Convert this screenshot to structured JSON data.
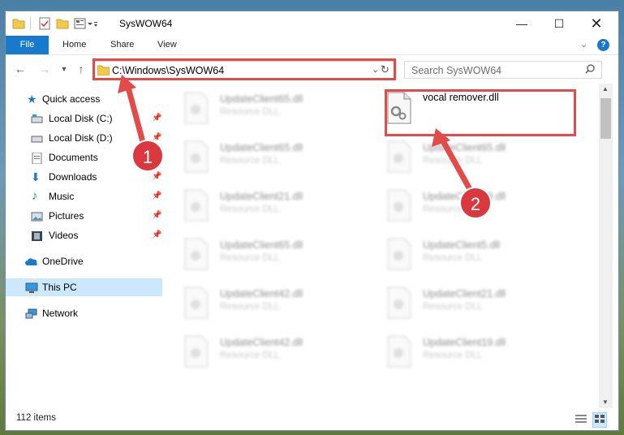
{
  "window": {
    "title": "SysWOW64"
  },
  "ribbon": {
    "tabs": [
      "File",
      "Home",
      "Share",
      "View"
    ]
  },
  "address": {
    "path": "C:\\Windows\\SysWOW64"
  },
  "search": {
    "placeholder": "Search SysWOW64"
  },
  "sidebar": {
    "items": [
      {
        "label": "Quick access"
      },
      {
        "label": "Local Disk (C:)"
      },
      {
        "label": "Local Disk (D:)"
      },
      {
        "label": "Documents"
      },
      {
        "label": "Downloads"
      },
      {
        "label": "Music"
      },
      {
        "label": "Pictures"
      },
      {
        "label": "Videos"
      },
      {
        "label": "OneDrive"
      },
      {
        "label": "This PC"
      },
      {
        "label": "Network"
      }
    ]
  },
  "files": {
    "highlighted": {
      "name": "vocal remover.dll"
    },
    "left": [
      {
        "name": "UpdateClient65.dll",
        "type": "Resource DLL"
      },
      {
        "name": "UpdateClient65.dll",
        "type": "Resource DLL"
      },
      {
        "name": "UpdateClient21.dll",
        "type": "Resource DLL"
      },
      {
        "name": "UpdateClient65.dll",
        "type": "Resource DLL"
      },
      {
        "name": "UpdateClient42.dll",
        "type": "Resource DLL"
      },
      {
        "name": "UpdateClient42.dll",
        "type": "Resource DLL"
      }
    ],
    "right": [
      {
        "name": "UpdateClient65.dll",
        "type": "Resource DLL"
      },
      {
        "name": "UpdateClient19.dll",
        "type": "Resource DLL"
      },
      {
        "name": "UpdateClient5.dll",
        "type": "Resource DLL"
      },
      {
        "name": "UpdateClient21.dll",
        "type": "Resource DLL"
      },
      {
        "name": "UpdateClient19.dll",
        "type": "Resource DLL"
      }
    ]
  },
  "status": {
    "item_count": "112 items"
  },
  "annotations": {
    "step1": "1",
    "step2": "2",
    "color": "#d9393e"
  }
}
